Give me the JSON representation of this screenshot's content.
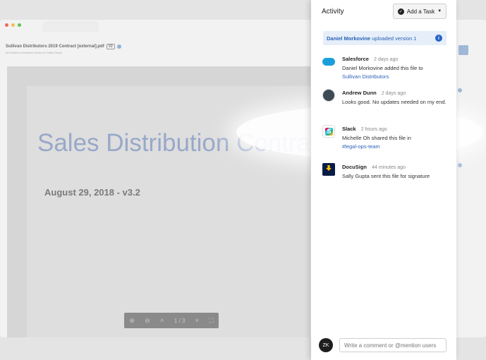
{
  "document": {
    "title": "Sullivan Distributors 2019 Contract [external].pdf",
    "version_badge": "V2",
    "breadcrumb": "All Folders ▸ Workflow Demo for Sales Deals",
    "heading": "Sales Distribution Contract",
    "subheading": "August 29, 2018 - v3.2",
    "page_indicator": "1 / 3"
  },
  "activity": {
    "title": "Activity",
    "add_task_label": "Add a Task",
    "version_banner": {
      "name": "Daniel Morkovine",
      "text": " uploaded version 1"
    },
    "items": [
      {
        "name": "Salesforce",
        "time": "2 days ago",
        "text": "Daniel Morkovine added this file to",
        "link": "Sullivan Distributors"
      },
      {
        "name": "Andrew Dunn",
        "time": "2 days ago",
        "text": "Looks good. No updates needed on my end."
      },
      {
        "name": "Slack",
        "time": "2 hours ago",
        "text": "Michelle Oh shared this file in",
        "link": "#legal-ops-team"
      },
      {
        "name": "DocuSign",
        "time": "44 minutes ago",
        "text": "Sally Gupta sent this file for signature"
      }
    ],
    "comment_placeholder": "Write a comment or @mention users",
    "user_initials": "ZK"
  },
  "colors": {
    "accent": "#2a62b7",
    "banner_bg": "#e5eef9",
    "salesforce": "#1a9fdc",
    "docusign_bg": "#0a1c46",
    "docusign_arrow": "#f5c400",
    "traffic_red": "#ed6a5e",
    "traffic_yellow": "#f5bf4f",
    "traffic_green": "#61c554"
  },
  "icons": {
    "add_task": "check-circle-icon",
    "caret": "chevron-down-icon",
    "info": "info-icon",
    "toolbar": [
      "zoom-in-icon",
      "zoom-out-icon",
      "page-up-icon",
      "page-down-icon",
      "fullscreen-icon"
    ]
  }
}
